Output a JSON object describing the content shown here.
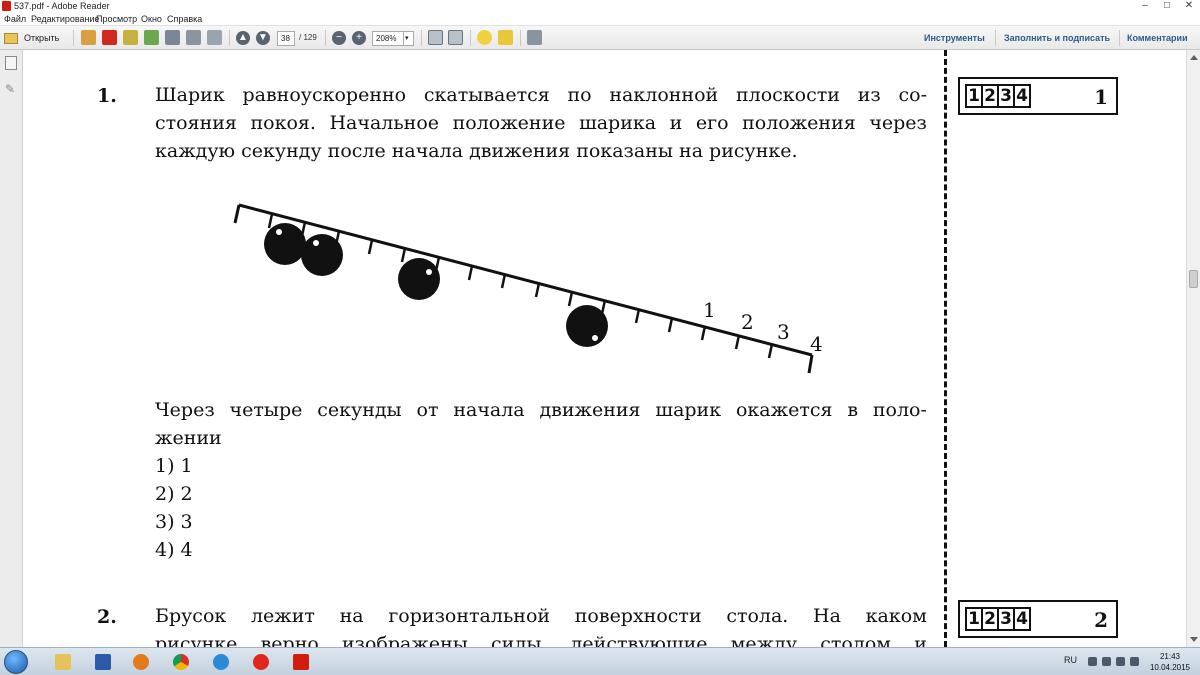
{
  "window": {
    "title": "537.pdf - Adobe Reader"
  },
  "menu": [
    "Файл",
    "Редактирование",
    "Просмотр",
    "Окно",
    "Справка"
  ],
  "toolbar": {
    "open_label": "Открыть",
    "page_current": "38",
    "page_total": "/ 129",
    "zoom": "208%",
    "links": [
      "Инструменты",
      "Заполнить и подписать",
      "Комментарии"
    ]
  },
  "document": {
    "q1": {
      "number": "1.",
      "text_lines": [
        [
          "Шарик",
          "равноускоренно",
          "скатывается",
          "по",
          "наклонной",
          "плоскости",
          "из",
          "со-"
        ],
        [
          "стояния",
          "покоя.",
          "Начальное",
          "положение",
          "шарика",
          "и",
          "его",
          "положения",
          "через"
        ],
        "каждую секунду после начала движения показаны на рисунке."
      ],
      "figure_labels": [
        "1",
        "2",
        "3",
        "4"
      ],
      "prompt_lines": [
        [
          "Через",
          "четыре",
          "секунды",
          "от",
          "начала",
          "движения",
          "шарик",
          "окажется",
          "в",
          "поло-"
        ],
        "жении"
      ],
      "options": [
        "1)  1",
        "2)  2",
        "3)  3",
        "4)  4"
      ],
      "answer_box": {
        "cells": [
          "1",
          "2",
          "3",
          "4"
        ],
        "question_id": "1"
      }
    },
    "q2": {
      "number": "2.",
      "text_lines": [
        [
          "Брусок",
          "лежит",
          "на",
          "горизонтальной",
          "поверхности",
          "стола.",
          "На",
          "каком"
        ],
        [
          "рисунке",
          "верно",
          "изображены",
          "силы,",
          "действующие",
          "между",
          "столом",
          "и"
        ]
      ],
      "answer_box": {
        "cells": [
          "1",
          "2",
          "3",
          "4"
        ],
        "question_id": "2"
      }
    }
  },
  "taskbar": {
    "language": "RU",
    "time": "21:43",
    "date": "10.04.2015"
  },
  "colors": {
    "toolbar_link": "#2f5a8a",
    "pdf_red": "#d21c0f",
    "taskbar": "#c3d1de"
  }
}
